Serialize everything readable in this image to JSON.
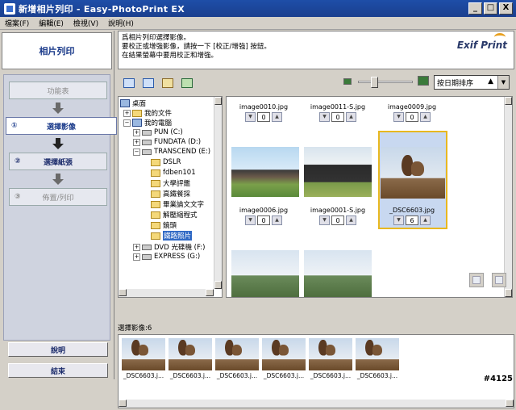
{
  "window": {
    "title": "新增相片列印 - Easy-PhotoPrint EX",
    "buttons": [
      "_",
      "□",
      "X"
    ]
  },
  "menu": [
    "檔案(F)",
    "編輯(E)",
    "檢視(V)",
    "說明(H)"
  ],
  "sidebar": {
    "title": "相片列印",
    "menu_button": "功能表",
    "steps": [
      {
        "num": "①",
        "label": "選擇影像",
        "state": "active"
      },
      {
        "num": "②",
        "label": "選擇紙張",
        "state": "enabled"
      },
      {
        "num": "③",
        "label": "佈置/列印",
        "state": "disabled"
      }
    ],
    "help_button": "說明",
    "exit_button": "結束"
  },
  "info": {
    "lines": [
      "爲相片列印選擇影像。",
      "要校正或增強影像，請按一下 [校正/增強] 按鈕。",
      "在結果螢幕中要用校正和增強。"
    ],
    "logo": "Exif Print"
  },
  "toolbar": {
    "icons": [
      "thumbnail-view-icon",
      "grid-view-icon",
      "correct-enhance-icon",
      "image-info-icon"
    ],
    "zoom_level": 0.25,
    "sort_label": "按日期排序",
    "sort_arrow": "▲"
  },
  "tree": {
    "items": [
      {
        "label": "桌面",
        "icon": "desktop"
      },
      {
        "label": "我的文件",
        "icon": "folder"
      },
      {
        "label": "我的電腦",
        "icon": "computer"
      },
      {
        "label": "PUN (C:)",
        "icon": "drive"
      },
      {
        "label": "FUNDATA (D:)",
        "icon": "drive"
      },
      {
        "label": "TRANSCEND (E:)",
        "icon": "drive"
      },
      {
        "label": "DSLR",
        "icon": "folder"
      },
      {
        "label": "fdben101",
        "icon": "folder"
      },
      {
        "label": "大學評鑑",
        "icon": "folder"
      },
      {
        "label": "高鐵餐採",
        "icon": "folder"
      },
      {
        "label": "畢業論文文字",
        "icon": "folder"
      },
      {
        "label": "解壓縮程式",
        "icon": "folder"
      },
      {
        "label": "鏡頭",
        "icon": "folder"
      },
      {
        "label": "鐵路照片",
        "icon": "folder",
        "selected": true
      },
      {
        "label": "DVD 光碟機 (F:)",
        "icon": "drive"
      },
      {
        "label": "EXPRESS (G:)",
        "icon": "drive"
      }
    ]
  },
  "thumbnails": [
    {
      "name": "image0010.jpg",
      "count": "0"
    },
    {
      "name": "image0011-S.jpg",
      "count": "0"
    },
    {
      "name": "image0009.jpg",
      "count": "0"
    },
    {
      "name": "image0006.jpg",
      "count": "0"
    },
    {
      "name": "image0001-S.jpg",
      "count": "0"
    },
    {
      "name": "_DSC6603.jpg",
      "count": "6"
    }
  ],
  "selected": {
    "label": "選擇影像:6",
    "items": [
      "_DSC6603.j...",
      "_DSC6603.j...",
      "_DSC6603.j...",
      "_DSC6603.j...",
      "_DSC6603.j...",
      "_DSC6603.j..."
    ]
  },
  "watermark": "#4125"
}
